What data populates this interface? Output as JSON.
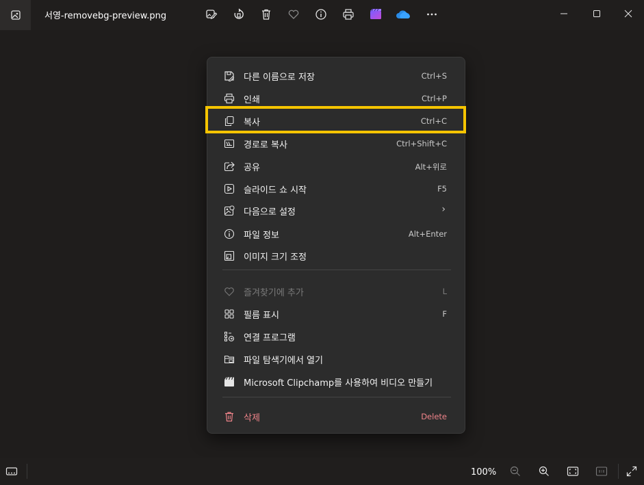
{
  "window": {
    "file_name": "서영-removebg-preview.png"
  },
  "toolbar": {
    "icons": [
      "edit-image-icon",
      "rotate-icon",
      "trash-icon",
      "heart-icon",
      "info-icon",
      "print-icon",
      "clipchamp-icon",
      "onedrive-icon",
      "more-icon"
    ]
  },
  "menu": {
    "items": [
      {
        "label": "다른 이름으로 저장",
        "shortcut": "Ctrl+S",
        "icon": "save-as-icon"
      },
      {
        "label": "인쇄",
        "shortcut": "Ctrl+P",
        "icon": "print-icon"
      },
      {
        "label": "복사",
        "shortcut": "Ctrl+C",
        "icon": "copy-icon"
      },
      {
        "label": "경로로 복사",
        "shortcut": "Ctrl+Shift+C",
        "icon": "copy-path-icon"
      },
      {
        "label": "공유",
        "shortcut": "Alt+위로",
        "icon": "share-icon"
      },
      {
        "label": "슬라이드 쇼 시작",
        "shortcut": "F5",
        "icon": "slideshow-icon"
      },
      {
        "label": "다음으로 설정",
        "shortcut": "›",
        "icon": "set-as-icon"
      },
      {
        "label": "파일 정보",
        "shortcut": "Alt+Enter",
        "icon": "info-icon"
      },
      {
        "label": "이미지 크기 조정",
        "shortcut": "",
        "icon": "resize-icon"
      },
      {
        "label": "즐겨찾기에 추가",
        "shortcut": "L",
        "icon": "heart-icon"
      },
      {
        "label": "필름 표시",
        "shortcut": "F",
        "icon": "filmstrip-icon"
      },
      {
        "label": "연결 프로그램",
        "shortcut": "",
        "icon": "open-with-icon"
      },
      {
        "label": "파일 탐색기에서 열기",
        "shortcut": "",
        "icon": "folder-icon"
      },
      {
        "label": "Microsoft Clipchamp를 사용하여 비디오 만들기",
        "shortcut": "",
        "icon": "clipchamp-icon"
      },
      {
        "label": "삭제",
        "shortcut": "Delete",
        "icon": "trash-icon"
      }
    ]
  },
  "status": {
    "zoom": "100%"
  },
  "colors": {
    "highlight": "#f5c400",
    "danger": "#f0848a",
    "menu_bg": "#2c2c2c",
    "window_bg": "#1f1d1c"
  }
}
